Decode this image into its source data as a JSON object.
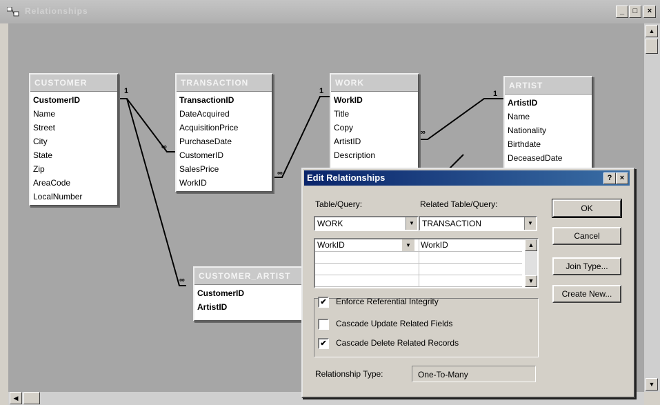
{
  "window": {
    "title": "Relationships",
    "min": "_",
    "max": "□",
    "close": "×"
  },
  "tables": {
    "customer": {
      "title": "CUSTOMER",
      "fields": [
        "CustomerID",
        "Name",
        "Street",
        "City",
        "State",
        "Zip",
        "AreaCode",
        "LocalNumber"
      ]
    },
    "transaction": {
      "title": "TRANSACTION",
      "fields": [
        "TransactionID",
        "DateAcquired",
        "AcquisitionPrice",
        "PurchaseDate",
        "CustomerID",
        "SalesPrice",
        "WorkID"
      ]
    },
    "work": {
      "title": "WORK",
      "fields": [
        "WorkID",
        "Title",
        "Copy",
        "ArtistID",
        "Description"
      ]
    },
    "artist": {
      "title": "ARTIST",
      "fields": [
        "ArtistID",
        "Name",
        "Nationality",
        "Birthdate",
        "DeceasedDate"
      ]
    },
    "customer_artist": {
      "title": "CUSTOMER_ARTIST",
      "fields": [
        "CustomerID",
        "ArtistID"
      ]
    }
  },
  "rel_labels": {
    "one": "1",
    "many": "∞"
  },
  "dialog": {
    "title": "Edit Relationships",
    "help": "?",
    "close": "×",
    "table_query_label": "Table/Query:",
    "related_label": "Related Table/Query:",
    "table_value": "WORK",
    "related_value": "TRANSACTION",
    "field_left": "WorkID",
    "field_right": "WorkID",
    "buttons": {
      "ok": "OK",
      "cancel": "Cancel",
      "join": "Join Type...",
      "create": "Create New..."
    },
    "checkboxes": {
      "enforce": {
        "label": "Enforce Referential Integrity",
        "checked": true
      },
      "cascade_update": {
        "label": "Cascade Update Related Fields",
        "checked": false
      },
      "cascade_delete": {
        "label": "Cascade Delete Related Records",
        "checked": true
      }
    },
    "reltype_label": "Relationship Type:",
    "reltype_value": "One-To-Many"
  }
}
